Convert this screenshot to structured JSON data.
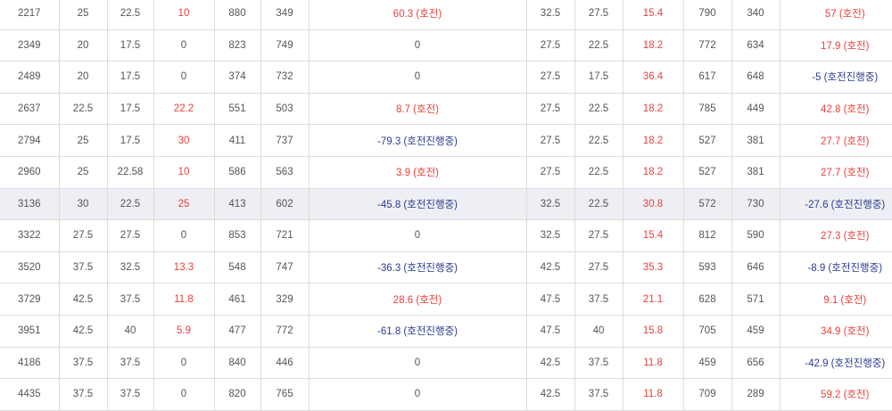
{
  "colors": {
    "good": "#e8413b",
    "bad": "#2a3d8f",
    "text": "#555555",
    "highlight_row": "#eeeff4",
    "grid": "#dcdcdc"
  },
  "rows": [
    {
      "id": "2217",
      "a": "25",
      "b": "22.5",
      "c": "10",
      "d": "880",
      "e": "349",
      "f": "60.3 (호전)",
      "g": "32.5",
      "h": "27.5",
      "i": "15.4",
      "j": "790",
      "k": "340",
      "l": "57 (호전)"
    },
    {
      "id": "2349",
      "a": "20",
      "b": "17.5",
      "c": "0",
      "d": "823",
      "e": "749",
      "f": "0",
      "g": "27.5",
      "h": "22.5",
      "i": "18.2",
      "j": "772",
      "k": "634",
      "l": "17.9 (호전)"
    },
    {
      "id": "2489",
      "a": "20",
      "b": "17.5",
      "c": "0",
      "d": "374",
      "e": "732",
      "f": "0",
      "g": "27.5",
      "h": "17.5",
      "i": "36.4",
      "j": "617",
      "k": "648",
      "l": "-5 (호전진행중)"
    },
    {
      "id": "2637",
      "a": "22.5",
      "b": "17.5",
      "c": "22.2",
      "d": "551",
      "e": "503",
      "f": "8.7 (호전)",
      "g": "27.5",
      "h": "22.5",
      "i": "18.2",
      "j": "785",
      "k": "449",
      "l": "42.8 (호전)"
    },
    {
      "id": "2794",
      "a": "25",
      "b": "17.5",
      "c": "30",
      "d": "411",
      "e": "737",
      "f": "-79.3 (호전진행중)",
      "g": "27.5",
      "h": "22.5",
      "i": "18.2",
      "j": "527",
      "k": "381",
      "l": "27.7 (호전)"
    },
    {
      "id": "2960",
      "a": "25",
      "b": "22.58",
      "c": "10",
      "d": "586",
      "e": "563",
      "f": "3.9 (호전)",
      "g": "27.5",
      "h": "22.5",
      "i": "18.2",
      "j": "527",
      "k": "381",
      "l": "27.7 (호전)"
    },
    {
      "id": "3136",
      "a": "30",
      "b": "22.5",
      "c": "25",
      "d": "413",
      "e": "602",
      "f": "-45.8 (호전진행중)",
      "g": "32.5",
      "h": "22.5",
      "i": "30.8",
      "j": "572",
      "k": "730",
      "l": "-27.6 (호전진행중)",
      "highlight": true
    },
    {
      "id": "3322",
      "a": "27.5",
      "b": "27.5",
      "c": "0",
      "d": "853",
      "e": "721",
      "f": "0",
      "g": "32.5",
      "h": "27.5",
      "i": "15.4",
      "j": "812",
      "k": "590",
      "l": "27.3 (호전)"
    },
    {
      "id": "3520",
      "a": "37.5",
      "b": "32.5",
      "c": "13.3",
      "d": "548",
      "e": "747",
      "f": "-36.3 (호전진행중)",
      "g": "42.5",
      "h": "27.5",
      "i": "35.3",
      "j": "593",
      "k": "646",
      "l": "-8.9 (호전진행중)"
    },
    {
      "id": "3729",
      "a": "42.5",
      "b": "37.5",
      "c": "11.8",
      "d": "461",
      "e": "329",
      "f": "28.6 (호전)",
      "g": "47.5",
      "h": "37.5",
      "i": "21.1",
      "j": "628",
      "k": "571",
      "l": "9.1 (호전)"
    },
    {
      "id": "3951",
      "a": "42.5",
      "b": "40",
      "c": "5.9",
      "d": "477",
      "e": "772",
      "f": "-61.8 (호전진행중)",
      "g": "47.5",
      "h": "40",
      "i": "15.8",
      "j": "705",
      "k": "459",
      "l": "34.9 (호전)"
    },
    {
      "id": "4186",
      "a": "37.5",
      "b": "37.5",
      "c": "0",
      "d": "840",
      "e": "446",
      "f": "0",
      "g": "42.5",
      "h": "37.5",
      "i": "11.8",
      "j": "459",
      "k": "656",
      "l": "-42.9 (호전진행중)"
    },
    {
      "id": "4435",
      "a": "37.5",
      "b": "37.5",
      "c": "0",
      "d": "820",
      "e": "765",
      "f": "0",
      "g": "42.5",
      "h": "37.5",
      "i": "11.8",
      "j": "709",
      "k": "289",
      "l": "59.2 (호전)"
    }
  ]
}
